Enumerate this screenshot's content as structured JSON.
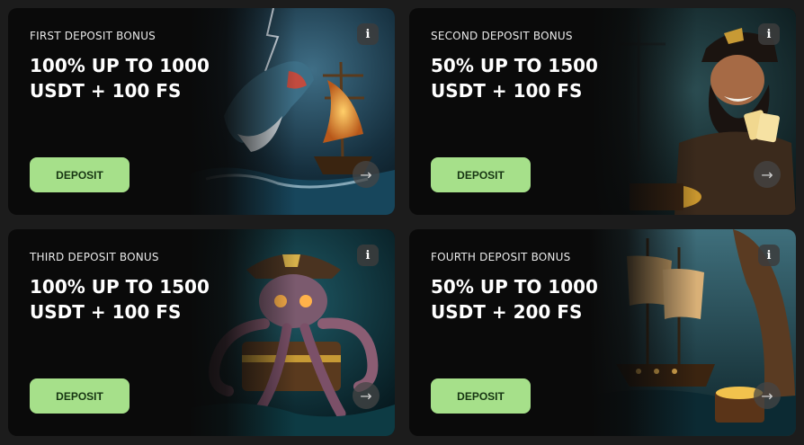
{
  "cards": [
    {
      "subtitle": "FIRST DEPOSIT BONUS",
      "headline_line1": "100% UP TO 1000",
      "headline_line2": "USDT + 100 FS",
      "button_label": "DEPOSIT",
      "info_label": "i",
      "arrow_label": "→",
      "art": "shark-and-pirate-ship"
    },
    {
      "subtitle": "SECOND DEPOSIT BONUS",
      "headline_line1": "50% UP TO 1500",
      "headline_line2": "USDT + 100 FS",
      "button_label": "DEPOSIT",
      "info_label": "i",
      "arrow_label": "→",
      "art": "laughing-pirate-with-cards"
    },
    {
      "subtitle": "THIRD DEPOSIT BONUS",
      "headline_line1": "100% UP TO 1500",
      "headline_line2": "USDT + 100 FS",
      "button_label": "DEPOSIT",
      "info_label": "i",
      "arrow_label": "→",
      "art": "octopus-pirate-on-chest"
    },
    {
      "subtitle": "FOURTH DEPOSIT BONUS",
      "headline_line1": "50% UP TO 1000",
      "headline_line2": "USDT + 200 FS",
      "button_label": "DEPOSIT",
      "info_label": "i",
      "arrow_label": "→",
      "art": "ship-in-cave-with-treasure"
    }
  ],
  "colors": {
    "background": "#1c1c1c",
    "card": "#0a0a0a",
    "button": "#a6e08a",
    "button_text": "#173513"
  }
}
